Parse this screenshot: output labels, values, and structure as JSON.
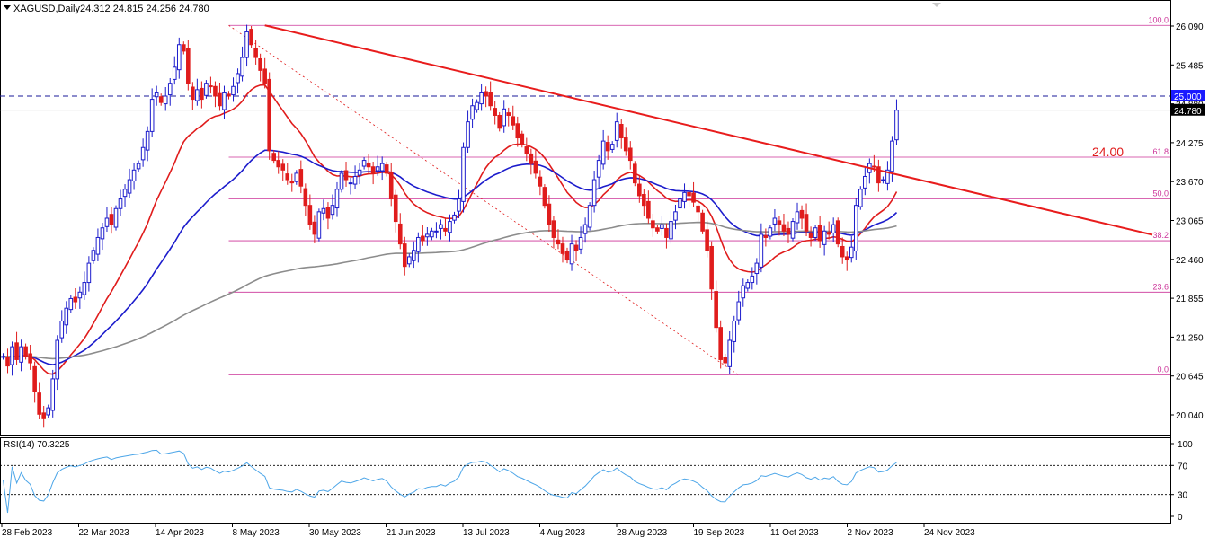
{
  "chart_data": [
    {
      "type": "candlestick",
      "symbol_label": "XAGUSD,Daily",
      "ohlc_header": "24.312 24.815 24.256 24.780",
      "y_ticks": [
        "26.090",
        "25.485",
        "24.880",
        "24.275",
        "23.670",
        "23.065",
        "22.460",
        "21.855",
        "21.250",
        "20.645",
        "20.040"
      ],
      "x_tick_labels": [
        "28 Feb 2023",
        "22 Mar 2023",
        "14 Apr 2023",
        "8 May 2023",
        "30 May 2023",
        "21 Jun 2023",
        "13 Jul 2023",
        "4 Aug 2023",
        "28 Aug 2023",
        "19 Sep 2023",
        "11 Oct 2023",
        "2 Nov 2023",
        "24 Nov 2023"
      ],
      "close_series": [
        20.95,
        20.8,
        21.1,
        20.9,
        21.1,
        20.95,
        20.85,
        20.4,
        20.05,
        19.98,
        20.15,
        20.6,
        21.2,
        21.5,
        21.7,
        21.85,
        21.8,
        21.95,
        22.1,
        22.4,
        22.6,
        22.8,
        22.95,
        23.1,
        23.0,
        23.25,
        23.4,
        23.55,
        23.7,
        23.85,
        23.95,
        24.2,
        24.45,
        24.95,
        25.05,
        24.9,
        25.0,
        25.2,
        25.45,
        25.8,
        25.7,
        25.2,
        24.95,
        25.1,
        24.95,
        25.2,
        25.15,
        25.0,
        24.85,
        25.05,
        25.0,
        25.15,
        25.35,
        25.6,
        26.0,
        25.8,
        25.6,
        25.4,
        25.2,
        24.15,
        24.0,
        23.9,
        23.85,
        23.7,
        23.65,
        23.8,
        23.6,
        23.3,
        23.0,
        22.85,
        23.2,
        23.25,
        23.1,
        23.3,
        23.55,
        23.8,
        23.7,
        23.65,
        23.75,
        23.85,
        24.0,
        23.9,
        23.8,
        23.9,
        23.95,
        23.8,
        23.4,
        23.05,
        22.7,
        22.35,
        22.5,
        22.6,
        22.8,
        22.75,
        22.85,
        22.9,
        22.9,
        23.0,
        22.9,
        23.05,
        23.15,
        23.4,
        24.2,
        24.6,
        24.85,
        24.9,
        25.05,
        25.0,
        24.85,
        24.7,
        24.5,
        24.8,
        24.7,
        24.55,
        24.35,
        24.25,
        24.1,
        23.95,
        23.8,
        23.6,
        23.3,
        23.0,
        22.8,
        22.7,
        22.55,
        22.45,
        22.7,
        22.6,
        22.8,
        23.0,
        23.3,
        23.7,
        24.0,
        24.3,
        24.15,
        24.25,
        24.6,
        24.35,
        24.15,
        24.0,
        23.65,
        23.45,
        23.3,
        23.1,
        22.95,
        22.9,
        23.0,
        22.8,
        23.05,
        23.2,
        23.4,
        23.5,
        23.45,
        23.35,
        23.2,
        22.9,
        22.6,
        22.0,
        21.4,
        20.9,
        20.85,
        21.2,
        21.5,
        21.8,
        22.05,
        22.1,
        22.2,
        22.4,
        22.85,
        22.8,
        22.95,
        23.1,
        23.0,
        22.9,
        22.85,
        23.05,
        23.2,
        23.1,
        22.9,
        22.8,
        22.95,
        22.75,
        22.9,
        22.85,
        23.0,
        22.7,
        22.5,
        22.45,
        22.65,
        23.3,
        23.55,
        23.75,
        23.95,
        23.9,
        23.65,
        23.7,
        23.85,
        24.3,
        24.78
      ],
      "resistance_label": "24.00",
      "price_tags": [
        "25.000",
        "24.780"
      ],
      "price_tag_colors": [
        "#1a1aff",
        "#000000"
      ],
      "fibonacci_levels": [
        "100.0",
        "61.8",
        "50.0",
        "38.2",
        "23.6",
        "0.0"
      ],
      "fibonacci_values": [
        26.1,
        24.05,
        23.4,
        22.75,
        21.95,
        20.66
      ],
      "fibonacci_color": "#cc3399",
      "horizontal_line_value": 25.0,
      "trendline_points": [
        [
          58,
          26.1
        ],
        [
          212,
          23.55
        ]
      ],
      "moving_average_colors": [
        "#e01c1c",
        "#1c1ccc",
        "#8c8c8c"
      ],
      "moving_average_periods": [
        20,
        50,
        200
      ],
      "colors": {
        "up": "#1c1ccc",
        "down": "#e01c1c",
        "trendline": "#e81c1c"
      }
    },
    {
      "type": "line",
      "indicator_label": "RSI(14) 70.3225",
      "y_ticks": [
        "100",
        "70",
        "30",
        "0"
      ],
      "levels": [
        70,
        30
      ],
      "line_color": "#4da6e8"
    }
  ]
}
